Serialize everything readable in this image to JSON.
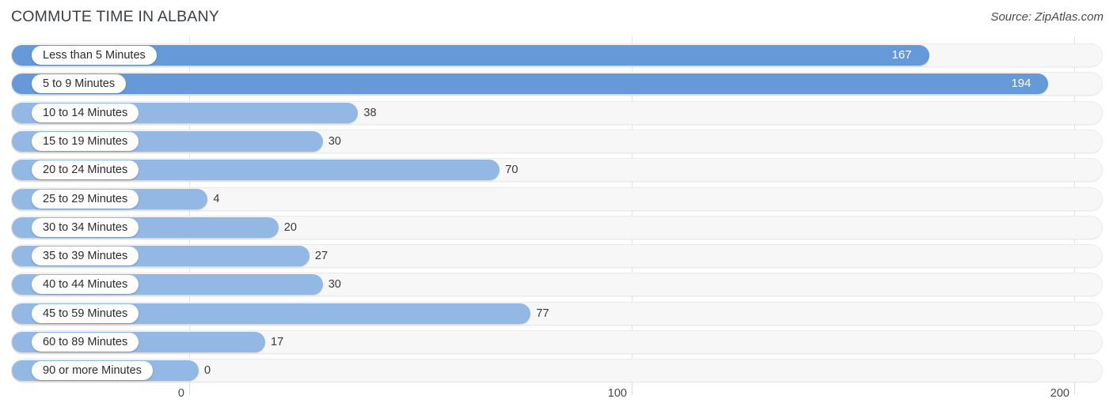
{
  "header": {
    "title": "COMMUTE TIME IN ALBANY",
    "source": "Source: ZipAtlas.com"
  },
  "colors": {
    "bar_strong": "#6699d8",
    "bar_light": "#93b8e4",
    "track": "#f7f7f7",
    "track_border": "#ebebeb",
    "gridline": "#e3e3e3",
    "title_text": "#3c4043",
    "value_text": "#37393b",
    "value_text_inside": "#ffffff"
  },
  "chart_data": {
    "type": "bar",
    "orientation": "horizontal",
    "title": "COMMUTE TIME IN ALBANY",
    "xlabel": "",
    "ylabel": "",
    "xlim": [
      0,
      200
    ],
    "grid": true,
    "legend": "none",
    "xticks": [
      "0",
      "100",
      "200"
    ],
    "xtick_values": [
      0,
      100,
      200
    ],
    "categories": [
      "Less than 5 Minutes",
      "5 to 9 Minutes",
      "10 to 14 Minutes",
      "15 to 19 Minutes",
      "20 to 24 Minutes",
      "25 to 29 Minutes",
      "30 to 34 Minutes",
      "35 to 39 Minutes",
      "40 to 44 Minutes",
      "45 to 59 Minutes",
      "60 to 89 Minutes",
      "90 or more Minutes"
    ],
    "values": [
      167,
      194,
      38,
      30,
      70,
      4,
      20,
      27,
      30,
      77,
      17,
      0
    ],
    "value_labels": [
      "167",
      "194",
      "38",
      "30",
      "70",
      "4",
      "20",
      "27",
      "30",
      "77",
      "17",
      "0"
    ]
  },
  "rows": [
    {
      "label": "Less than 5 Minutes",
      "value": 167,
      "value_label": "167",
      "label_inside": true
    },
    {
      "label": "5 to 9 Minutes",
      "value": 194,
      "value_label": "194",
      "label_inside": true
    },
    {
      "label": "10 to 14 Minutes",
      "value": 38,
      "value_label": "38",
      "label_inside": false
    },
    {
      "label": "15 to 19 Minutes",
      "value": 30,
      "value_label": "30",
      "label_inside": false
    },
    {
      "label": "20 to 24 Minutes",
      "value": 70,
      "value_label": "70",
      "label_inside": false
    },
    {
      "label": "25 to 29 Minutes",
      "value": 4,
      "value_label": "4",
      "label_inside": false
    },
    {
      "label": "30 to 34 Minutes",
      "value": 20,
      "value_label": "20",
      "label_inside": false
    },
    {
      "label": "35 to 39 Minutes",
      "value": 27,
      "value_label": "27",
      "label_inside": false
    },
    {
      "label": "40 to 44 Minutes",
      "value": 30,
      "value_label": "30",
      "label_inside": false
    },
    {
      "label": "45 to 59 Minutes",
      "value": 77,
      "value_label": "77",
      "label_inside": false
    },
    {
      "label": "60 to 89 Minutes",
      "value": 17,
      "value_label": "17",
      "label_inside": false
    },
    {
      "label": "90 or more Minutes",
      "value": 0,
      "value_label": "0",
      "label_inside": false
    }
  ],
  "axis": {
    "ticks": [
      {
        "label": "0",
        "value": 0
      },
      {
        "label": "100",
        "value": 100
      },
      {
        "label": "200",
        "value": 200
      }
    ]
  }
}
